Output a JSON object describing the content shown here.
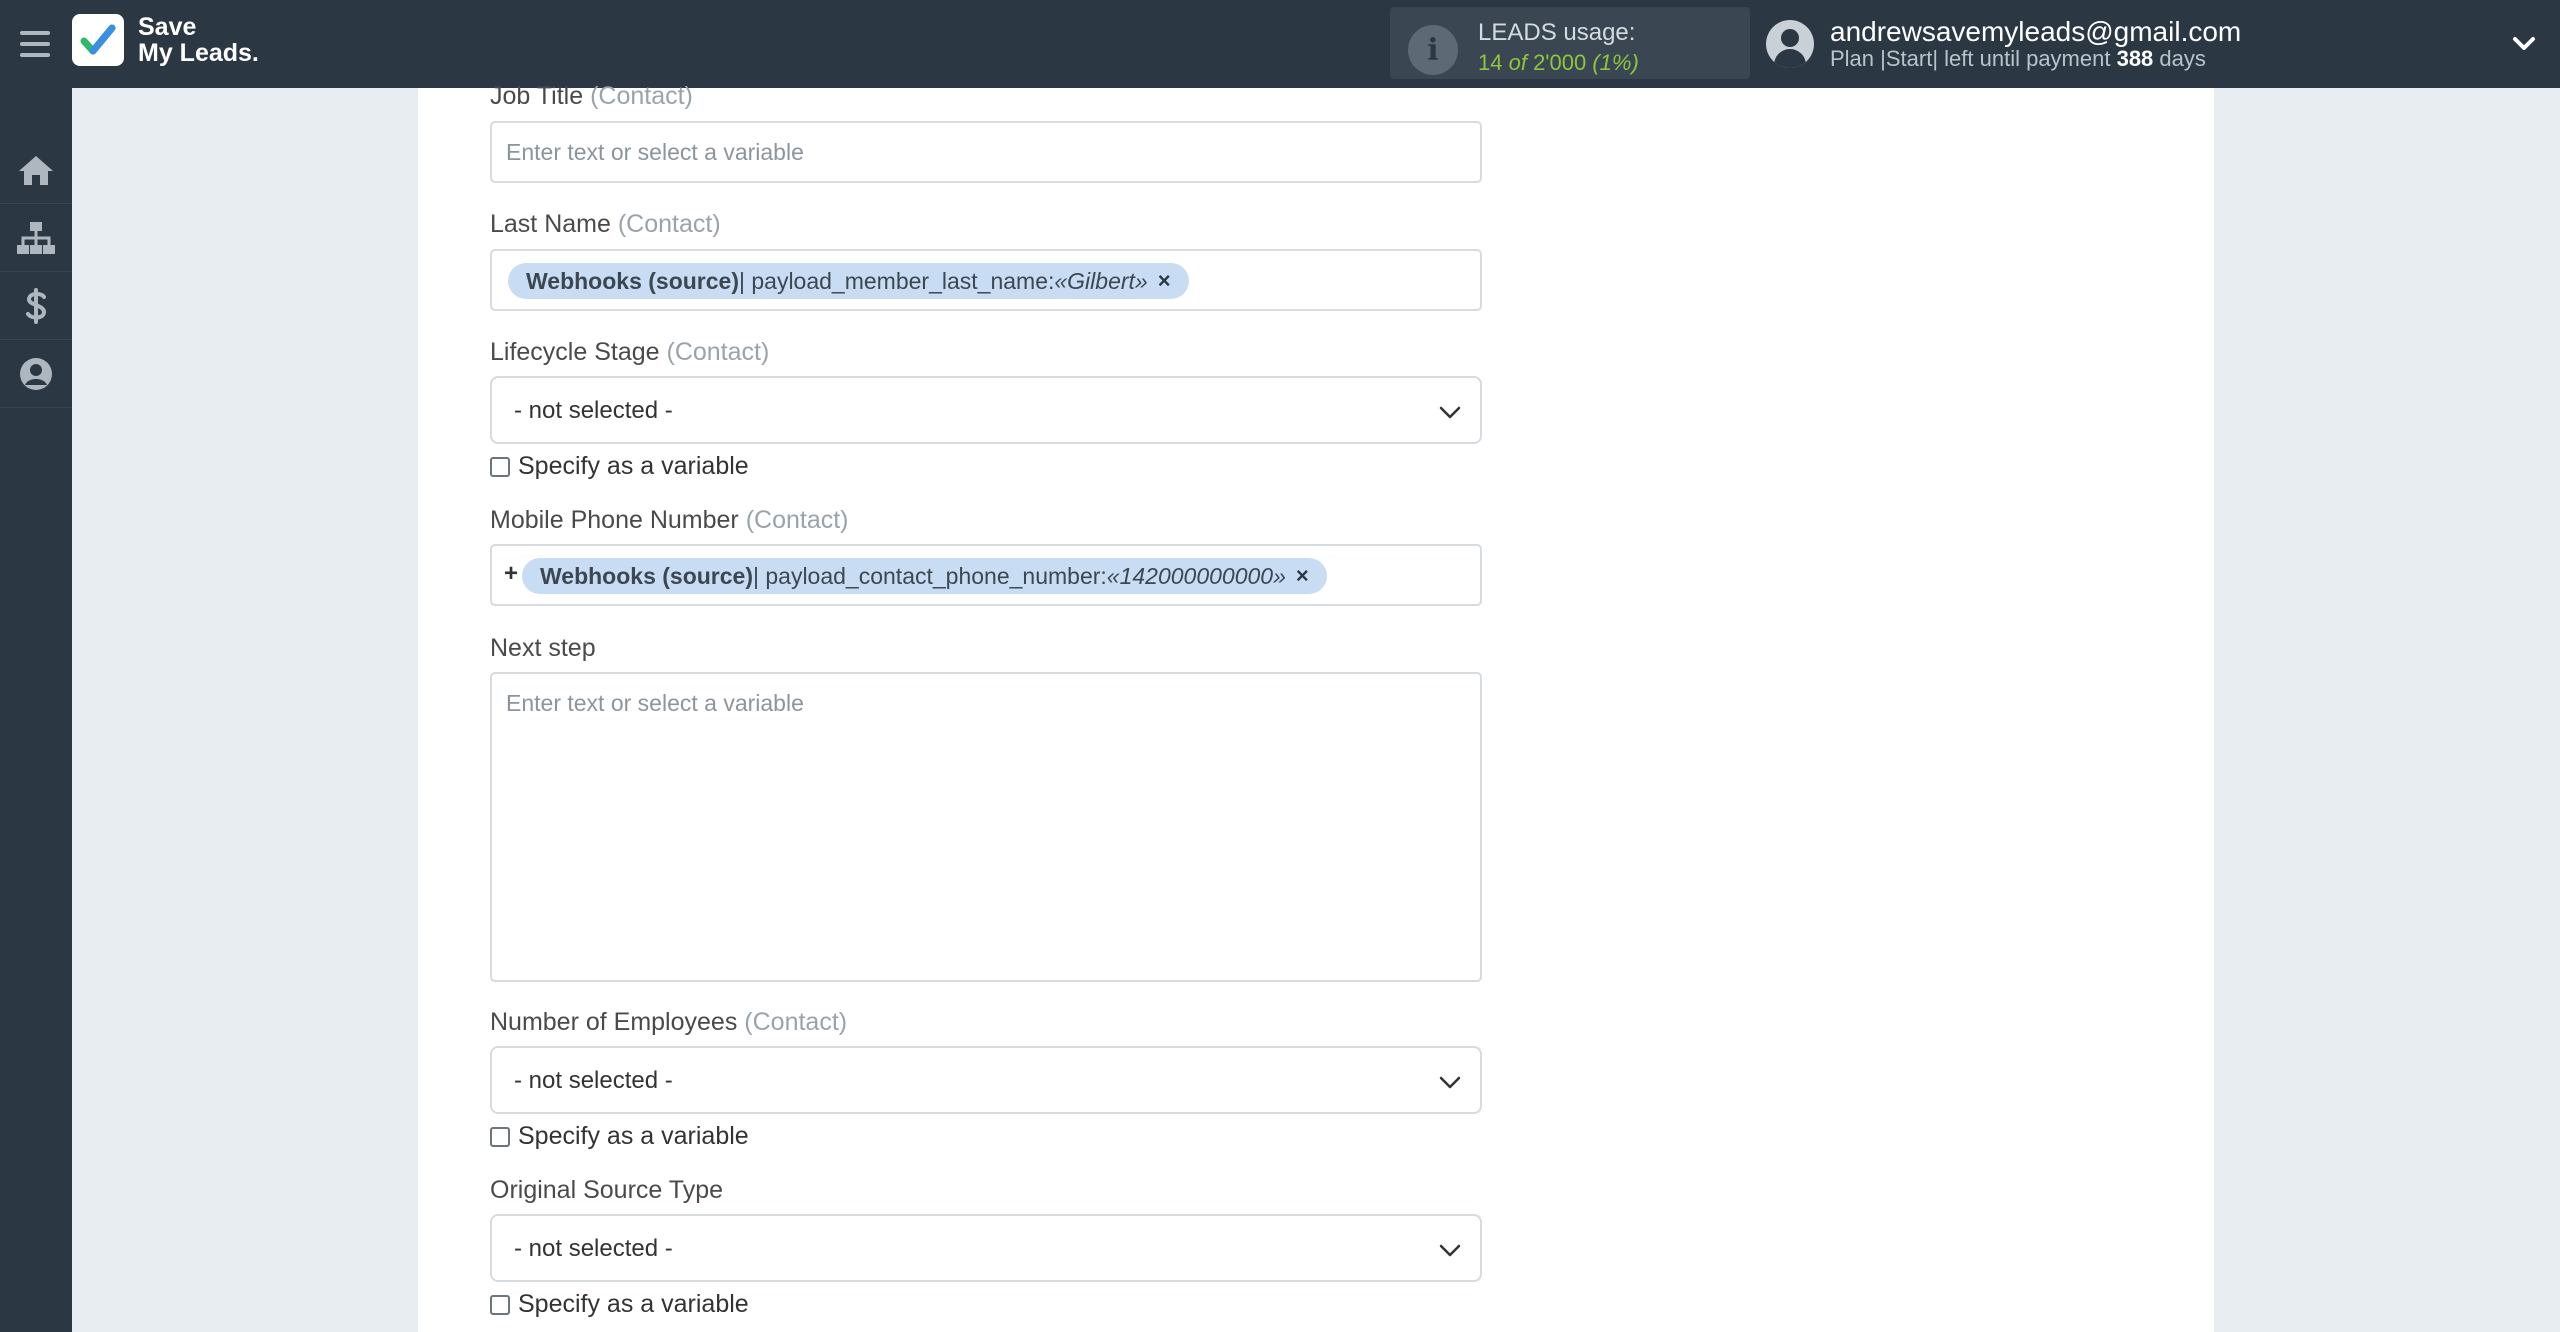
{
  "brand": {
    "line1": "Save",
    "line2": "My Leads."
  },
  "usage": {
    "title": "LEADS usage:",
    "used": "14",
    "of_text": " of ",
    "total": "2'000",
    "percent": " (1%)"
  },
  "account": {
    "email": "andrewsavemyleads@gmail.com",
    "plan_prefix": "Plan |Start| left until payment ",
    "days": "388",
    "days_suffix": " days"
  },
  "sidebar": {
    "items": [
      "home-icon",
      "sitemap-icon",
      "dollar-icon",
      "user-icon"
    ]
  },
  "form": {
    "job_title": {
      "label": "Job Title",
      "scope": "(Contact)",
      "placeholder": "Enter text or select a variable"
    },
    "last_name": {
      "label": "Last Name",
      "scope": "(Contact)",
      "tag": {
        "source": "Webhooks (source)",
        "field": " | payload_member_last_name: ",
        "value": "«Gilbert»",
        "remove": "×"
      }
    },
    "lifecycle_stage": {
      "label": "Lifecycle Stage",
      "scope": "(Contact)",
      "value": "- not selected -",
      "checkbox": "Specify as a variable"
    },
    "mobile_phone": {
      "label": "Mobile Phone Number",
      "scope": "(Contact)",
      "prefix": "+",
      "tag": {
        "source": "Webhooks (source)",
        "field": " | payload_contact_phone_number: ",
        "value": "«142000000000»",
        "remove": "×"
      }
    },
    "next_step": {
      "label": "Next step",
      "placeholder": "Enter text or select a variable"
    },
    "employees": {
      "label": "Number of Employees",
      "scope": "(Contact)",
      "value": "- not selected -",
      "checkbox": "Specify as a variable"
    },
    "source_type": {
      "label": "Original Source Type",
      "value": "- not selected -",
      "checkbox": "Specify as a variable"
    }
  },
  "colors": {
    "topbar": "#2b3844",
    "accent_green": "#8cc63f",
    "tag_bg": "#c8ddf4"
  }
}
